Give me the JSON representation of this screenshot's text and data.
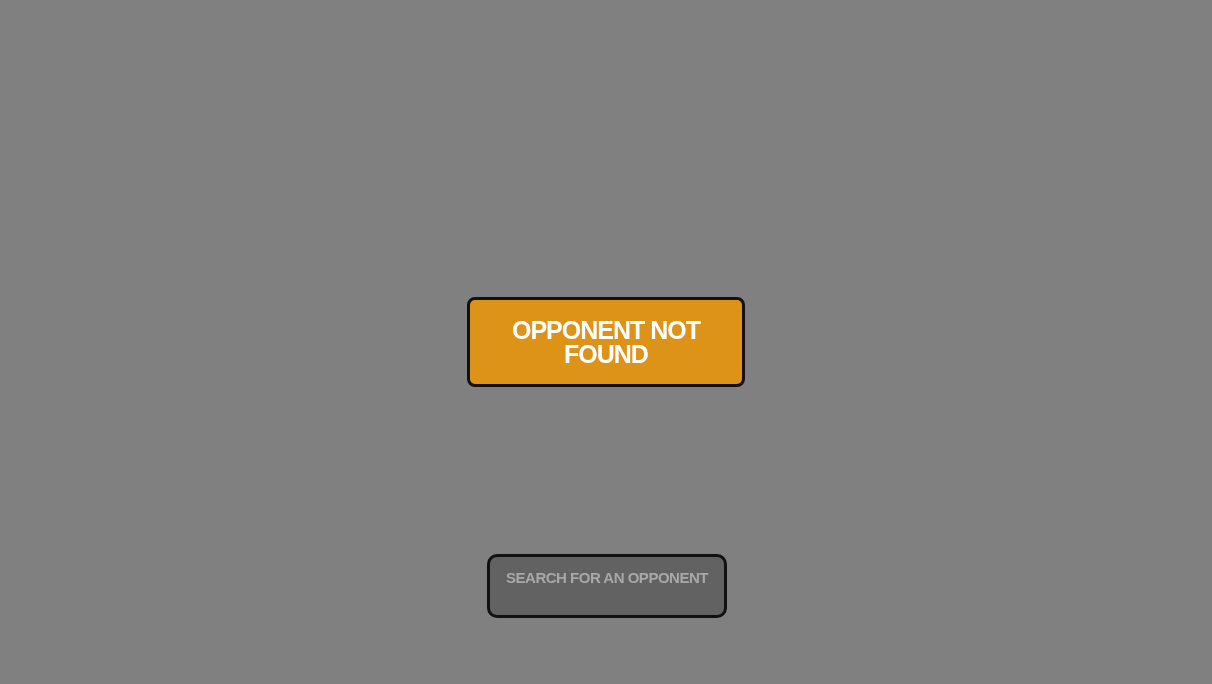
{
  "message": {
    "text": "OPPONENT NOT FOUND"
  },
  "search_button": {
    "label": "SEARCH FOR AN OPPONENT",
    "disabled": true
  }
}
